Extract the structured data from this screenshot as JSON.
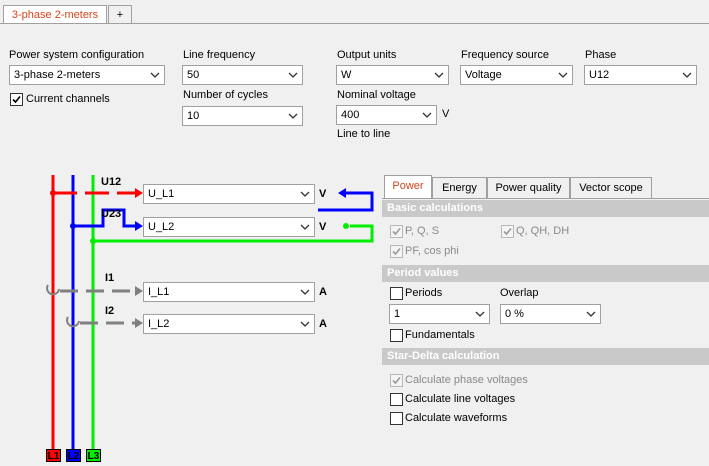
{
  "tabs": [
    {
      "label": "3-phase 2-meters",
      "active": true
    },
    {
      "label": "+"
    }
  ],
  "config": {
    "power_system_label": "Power system configuration",
    "power_system_value": "3-phase 2-meters",
    "current_channels_label": "Current channels",
    "current_channels_checked": true,
    "line_frequency_label": "Line frequency",
    "line_frequency_value": "50",
    "cycles_label": "Number of cycles",
    "cycles_value": "10",
    "output_units_label": "Output units",
    "output_units_value": "W",
    "nominal_voltage_label": "Nominal voltage",
    "nominal_voltage_value": "400",
    "nominal_voltage_unit": "V",
    "line_to_line_label": "Line to line",
    "frequency_source_label": "Frequency source",
    "frequency_source_value": "Voltage",
    "phase_label": "Phase",
    "phase_value": "U12"
  },
  "diagram": {
    "u12_label": "U12",
    "u23_label": "U23",
    "i1_label": "I1",
    "i2_label": "I2",
    "channels": [
      {
        "name": "U_L1",
        "unit": "V"
      },
      {
        "name": "U_L2",
        "unit": "V"
      },
      {
        "name": "I_L1",
        "unit": "A"
      },
      {
        "name": "I_L2",
        "unit": "A"
      }
    ],
    "phases": [
      "L1",
      "L2",
      "L3"
    ],
    "colors": {
      "l1": "#ff0000",
      "l2": "#0000ff",
      "l3": "#00ee00",
      "current": "#808080"
    }
  },
  "right_tabs": [
    {
      "label": "Power",
      "active": true
    },
    {
      "label": "Energy"
    },
    {
      "label": "Power quality"
    },
    {
      "label": "Vector scope"
    }
  ],
  "basic": {
    "title": "Basic calculations",
    "pqs": "P, Q, S",
    "qqhdh": "Q, QH, DH",
    "pf": "PF, cos phi"
  },
  "period": {
    "title": "Period values",
    "periods_label": "Periods",
    "periods_value": "1",
    "overlap_label": "Overlap",
    "overlap_value": "0 %",
    "fundamentals_label": "Fundamentals"
  },
  "stardelta": {
    "title": "Star-Delta calculation",
    "phase_voltages": "Calculate phase voltages",
    "line_voltages": "Calculate line voltages",
    "waveforms": "Calculate waveforms"
  }
}
